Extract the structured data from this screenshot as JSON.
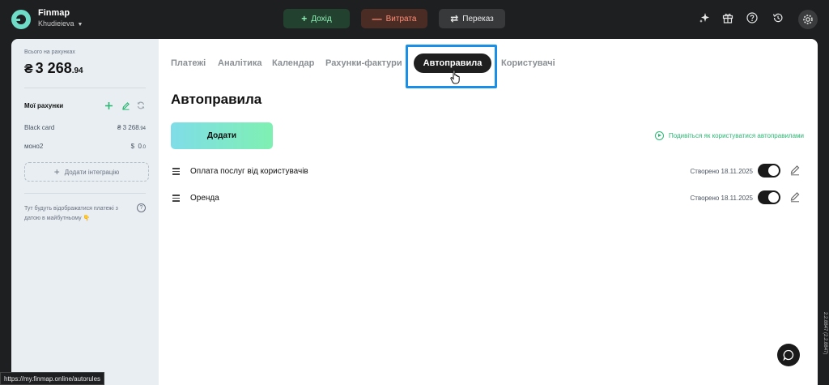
{
  "brand": {
    "name": "Finmap",
    "user": "Khudieieva"
  },
  "top_actions": {
    "income": "Дохід",
    "expense": "Витрата",
    "transfer": "Переказ"
  },
  "sidebar": {
    "total_label": "Всього на рахунках",
    "total_currency": "₴",
    "total_main": "3 268",
    "total_cents": ".94",
    "accounts_title": "Мої рахунки",
    "accounts": [
      {
        "name": "Black card",
        "currency": "₴",
        "amount": "3 268",
        "cents": ".94"
      },
      {
        "name": "моно2",
        "currency": "$",
        "amount": "0",
        "cents": ".0"
      }
    ],
    "add_integration": "Додати інтеграцію",
    "future_text": "Тут будуть відображатися платежі з датою в майбутньому 👇"
  },
  "tabs": [
    "Платежі",
    "Аналітика",
    "Календар",
    "Рахунки-фактури",
    "Автоправила",
    "Користувачі"
  ],
  "active_tab": "Автоправила",
  "page": {
    "title": "Автоправила",
    "add_button": "Додати",
    "howto_link": "Подивіться як користуватися автоправилами"
  },
  "rules": [
    {
      "name": "Оплата послуг від користувачів",
      "created": "Створено 18.11.2025",
      "enabled": true
    },
    {
      "name": "Оренда",
      "created": "Створено 18.11.2025",
      "enabled": true
    }
  ],
  "status_url": "https://my.finmap.online/autorules",
  "version": "2.2.8847 (2.2.8847)"
}
